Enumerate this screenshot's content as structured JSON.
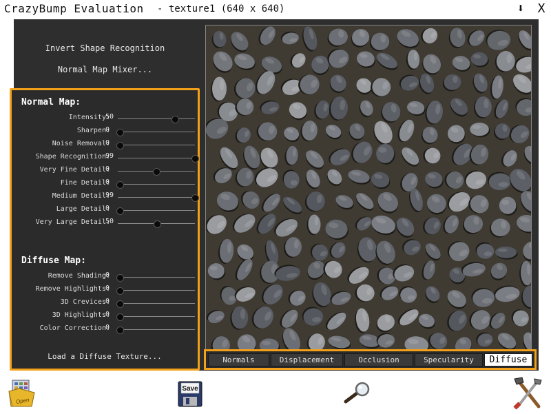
{
  "app": {
    "title": "CrazyBump Evaluation",
    "document": "- texture1 (640 x 640)",
    "download_glyph": "⬇",
    "close_glyph": "X"
  },
  "options": {
    "invert": "Invert Shape Recognition",
    "mixer": "Normal Map Mixer..."
  },
  "normal_map": {
    "title": "Normal Map:",
    "params": [
      {
        "label": "Intensity:",
        "value": "50",
        "level": 0.74
      },
      {
        "label": "Sharpen:",
        "value": "0",
        "level": 0.03
      },
      {
        "label": "Noise Removal:",
        "value": "0",
        "level": 0.03
      },
      {
        "label": "Shape Recognition:",
        "value": "99",
        "level": 1.0
      },
      {
        "label": "Very Fine Detail:",
        "value": "0",
        "level": 0.5
      },
      {
        "label": "Fine Detail:",
        "value": "0",
        "level": 0.03
      },
      {
        "label": "Medium Detail:",
        "value": "99",
        "level": 1.0
      },
      {
        "label": "Large Detail:",
        "value": "0",
        "level": 0.03
      },
      {
        "label": "Very Large Detail:",
        "value": "50",
        "level": 0.51
      }
    ]
  },
  "diffuse_map": {
    "title": "Diffuse Map:",
    "params": [
      {
        "label": "Remove Shading:",
        "value": "0",
        "level": 0.03
      },
      {
        "label": "Remove Highlights:",
        "value": "0",
        "level": 0.03
      },
      {
        "label": "3D Crevices:",
        "value": "0",
        "level": 0.03
      },
      {
        "label": "3D Highlights:",
        "value": "0",
        "level": 0.03
      },
      {
        "label": "Color Correction:",
        "value": "0",
        "level": 0.03
      }
    ],
    "load": "Load a Diffuse Texture..."
  },
  "tabs": [
    {
      "label": "Normals",
      "active": false
    },
    {
      "label": "Displacement",
      "active": false
    },
    {
      "label": "Occlusion",
      "active": false
    },
    {
      "label": "Specularity",
      "active": false
    },
    {
      "label": "Diffuse",
      "active": true
    }
  ],
  "toolbar": {
    "open_label": "Open",
    "save_label": "Save"
  }
}
